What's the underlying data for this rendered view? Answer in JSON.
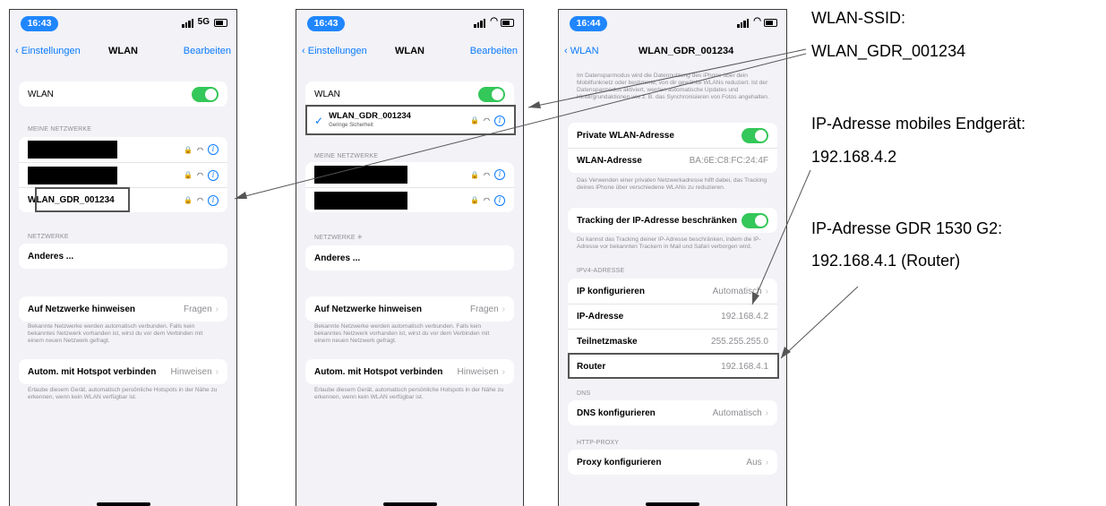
{
  "p1": {
    "time": "16:43",
    "net": "5G",
    "nav": {
      "back": "Einstellungen",
      "title": "WLAN",
      "edit": "Bearbeiten"
    },
    "wlan_label": "WLAN",
    "my_networks_header": "MEINE NETZWERKE",
    "my_networks": [
      "WLAN_GDR_001234"
    ],
    "networks_header": "NETZWERKE",
    "other": "Anderes ...",
    "ask_label": "Auf Netzwerke hinweisen",
    "ask_value": "Fragen",
    "ask_foot": "Bekannte Netzwerke werden automatisch verbunden. Falls kein bekanntes Netzwerk vorhanden ist, wirst du vor dem Verbinden mit einem neuen Netzwerk gefragt.",
    "hotspot_label": "Autom. mit Hotspot verbinden",
    "hotspot_value": "Hinweisen",
    "hotspot_foot": "Erlaube diesem Gerät, automatisch persönliche Hotspots in der Nähe zu erkennen, wenn kein WLAN verfügbar ist."
  },
  "p2": {
    "time": "16:43",
    "nav": {
      "back": "Einstellungen",
      "title": "WLAN",
      "edit": "Bearbeiten"
    },
    "wlan_label": "WLAN",
    "connected_ssid": "WLAN_GDR_001234",
    "connected_sub": "Geringe Sicherheit",
    "my_networks_header": "MEINE NETZWERKE",
    "networks_header": "NETZWERKE",
    "other": "Anderes ...",
    "ask_label": "Auf Netzwerke hinweisen",
    "ask_value": "Fragen",
    "ask_foot": "Bekannte Netzwerke werden automatisch verbunden. Falls kein bekanntes Netzwerk vorhanden ist, wirst du vor dem Verbinden mit einem neuen Netzwerk gefragt.",
    "hotspot_label": "Autom. mit Hotspot verbinden",
    "hotspot_value": "Hinweisen",
    "hotspot_foot": "Erlaube diesem Gerät, automatisch persönliche Hotspots in der Nähe zu erkennen, wenn kein WLAN verfügbar ist."
  },
  "p3": {
    "time": "16:44",
    "nav": {
      "back": "WLAN",
      "title": "WLAN_GDR_001234"
    },
    "top_foot": "Im Datensparmodus wird die Datennutzung des iPhone über dein Mobilfunknetz oder bestimmte, von dir gewählte WLANs reduziert. Ist der Datensparmodus aktiviert, werden automatische Updates und Hintergrundaktionen wie z. B. das Synchronisieren von Fotos angehalten.",
    "private_label": "Private WLAN-Adresse",
    "wlan_addr_label": "WLAN-Adresse",
    "wlan_addr_value": "BA:6E:C8:FC:24:4F",
    "private_foot": "Das Verwenden einer privaten Netzwerkadresse hilft dabei, das Tracking deines iPhone über verschiedene WLANs zu reduzieren.",
    "tracking_label": "Tracking der IP-Adresse beschränken",
    "tracking_foot": "Du kannst das Tracking deiner IP-Adresse beschränken, indem die IP-Adresse vor bekannten Trackern in Mail und Safari verborgen wird.",
    "ipv4_header": "IPV4-ADRESSE",
    "ip_config_label": "IP konfigurieren",
    "ip_config_value": "Automatisch",
    "ip_label": "IP-Adresse",
    "ip_value": "192.168.4.2",
    "mask_label": "Teilnetzmaske",
    "mask_value": "255.255.255.0",
    "router_label": "Router",
    "router_value": "192.168.4.1",
    "dns_header": "DNS",
    "dns_label": "DNS konfigurieren",
    "dns_value": "Automatisch",
    "proxy_header": "HTTP-PROXY",
    "proxy_label": "Proxy konfigurieren",
    "proxy_value": "Aus"
  },
  "annotations": {
    "ssid_title": "WLAN-SSID:",
    "ssid_value": "WLAN_GDR_001234",
    "device_ip_title": "IP-Adresse mobiles Endgerät:",
    "device_ip_value": "192.168.4.2",
    "gdr_ip_title": "IP-Adresse GDR 1530 G2:",
    "gdr_ip_value": "192.168.4.1 (Router)"
  },
  "colors": {
    "accent": "#0a7aff",
    "toggle": "#34c759",
    "pill": "#1f86ff"
  }
}
